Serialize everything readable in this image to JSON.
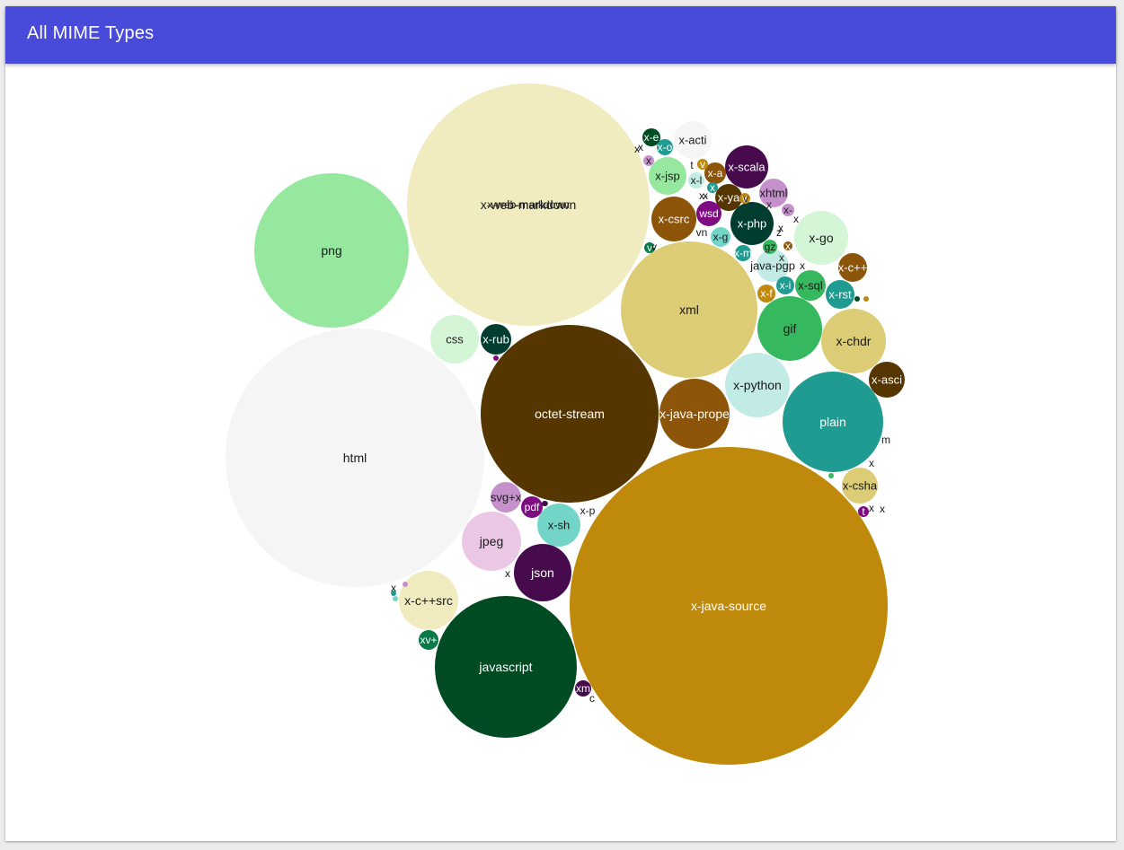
{
  "header": {
    "title": "All MIME Types",
    "color": "#484bd9"
  },
  "chart_data": {
    "type": "packed-bubble",
    "title": "All MIME Types",
    "bubbles": [
      {
        "label": "x-java-source",
        "color": "#bf8a0c"
      },
      {
        "label": "html",
        "color": "#f5f5f5"
      },
      {
        "label": "x-web-markdown",
        "color": "#f1ecc0"
      },
      {
        "label": "octet-stream",
        "color": "#553600"
      },
      {
        "label": "png",
        "color": "#95e89e"
      },
      {
        "label": "javascript",
        "color": "#004b22"
      },
      {
        "label": "xml",
        "color": "#dbcc75"
      },
      {
        "label": "plain",
        "color": "#1f9b91"
      },
      {
        "label": "x-python",
        "color": "#c2ebe6"
      },
      {
        "label": "x-java-prope",
        "color": "#8c5509"
      },
      {
        "label": "gif",
        "color": "#36b85e"
      },
      {
        "label": "x-chdr",
        "color": "#dbcc75"
      },
      {
        "label": "x-web-markdown",
        "color": "#f1ecc0"
      },
      {
        "label": "jpeg",
        "color": "#eac8e5"
      },
      {
        "label": "x-c++src",
        "color": "#f1ecc0"
      },
      {
        "label": "json",
        "color": "#470a4d"
      },
      {
        "label": "x-go",
        "color": "#d4f6d6"
      },
      {
        "label": "css",
        "color": "#d4f6d6"
      },
      {
        "label": "x-csrc",
        "color": "#8c5509"
      },
      {
        "label": "x-scala",
        "color": "#470a4d"
      },
      {
        "label": "x-php",
        "color": "#003c30"
      },
      {
        "label": "x-acti",
        "color": "#f5f5f5"
      },
      {
        "label": "x-jsp",
        "color": "#95e89e"
      },
      {
        "label": "x-sh",
        "color": "#73d5c8"
      },
      {
        "label": "x-csha",
        "color": "#dbcc75"
      },
      {
        "label": "x-asci",
        "color": "#553600"
      },
      {
        "label": "x-rub",
        "color": "#003c30"
      },
      {
        "label": "java-pgp",
        "color": "#c2ebe6"
      },
      {
        "label": "xhtml",
        "color": "#c591cc"
      },
      {
        "label": "x-sql",
        "color": "#36b85e"
      },
      {
        "label": "x-rst",
        "color": "#1f9b91"
      },
      {
        "label": "x-c++",
        "color": "#8c5509"
      },
      {
        "label": "svg+x",
        "color": "#c591cc"
      },
      {
        "label": "x-ya",
        "color": "#553600"
      },
      {
        "label": "wsd",
        "color": "#7e0b81"
      },
      {
        "label": "pdf",
        "color": "#7e0b81"
      },
      {
        "label": "x-a",
        "color": "#8c5509"
      },
      {
        "label": "x-g",
        "color": "#73d5c8"
      },
      {
        "label": "x-i",
        "color": "#1f9b91"
      },
      {
        "label": "x-f",
        "color": "#bf8a0c"
      },
      {
        "label": "x-m",
        "color": "#1f9b91"
      },
      {
        "label": "x-e",
        "color": "#004b22"
      },
      {
        "label": "x-o",
        "color": "#1f9b91"
      },
      {
        "label": "x-l",
        "color": "#c2ebe6"
      },
      {
        "label": "xv+",
        "color": "#067a47"
      },
      {
        "label": "xm",
        "color": "#470a4d"
      },
      {
        "label": "gz",
        "color": "#36b85e"
      },
      {
        "label": "x-",
        "color": "#c591cc"
      },
      {
        "label": "x",
        "color": "#8c5509"
      },
      {
        "label": "x",
        "color": "#c591cc"
      },
      {
        "label": "v",
        "color": "#067a47"
      },
      {
        "label": "v",
        "color": "#bf8a0c"
      },
      {
        "label": "v",
        "color": "#bf8a0c"
      },
      {
        "label": "x",
        "color": "#1f9b91"
      },
      {
        "label": "t",
        "color": "#7e0b81"
      },
      {
        "label": "x-p",
        "color": "#ffffff"
      },
      {
        "label": "c",
        "color": "#ffffff"
      },
      {
        "label": "vn",
        "color": "#ffffff"
      },
      {
        "label": "x-",
        "color": "#ffffff"
      },
      {
        "label": "x",
        "color": "#ffffff"
      },
      {
        "label": "x",
        "color": "#ffffff"
      },
      {
        "label": "x",
        "color": "#ffffff"
      },
      {
        "label": "x",
        "color": "#ffffff"
      },
      {
        "label": "t",
        "color": "#ffffff"
      },
      {
        "label": "v",
        "color": "#ffffff"
      },
      {
        "label": "x",
        "color": "#ffffff"
      },
      {
        "label": "z",
        "color": "#ffffff"
      },
      {
        "label": "m",
        "color": "#ffffff"
      },
      {
        "label": "x",
        "color": "#ffffff"
      },
      {
        "label": "x",
        "color": "#ffffff"
      },
      {
        "label": "v",
        "color": "#ffffff"
      },
      {
        "label": "x",
        "color": "#ffffff"
      },
      {
        "label": "x",
        "color": "#ffffff"
      },
      {
        "label": "x",
        "color": "#ffffff"
      },
      {
        "label": "x",
        "color": "#ffffff"
      },
      {
        "label": "x",
        "color": "#ffffff"
      },
      {
        "label": "x",
        "color": "#ffffff"
      },
      {
        "label": "",
        "color": "#067a47"
      },
      {
        "label": "",
        "color": "#1f9b91"
      },
      {
        "label": "",
        "color": "#73d5c8"
      },
      {
        "label": "",
        "color": "#7e0b81"
      },
      {
        "label": "",
        "color": "#470a4d"
      },
      {
        "label": "",
        "color": "#c591cc"
      },
      {
        "label": "",
        "color": "#36b85e"
      },
      {
        "label": "",
        "color": "#004b22"
      },
      {
        "label": "",
        "color": "#bf8a0c"
      }
    ]
  }
}
